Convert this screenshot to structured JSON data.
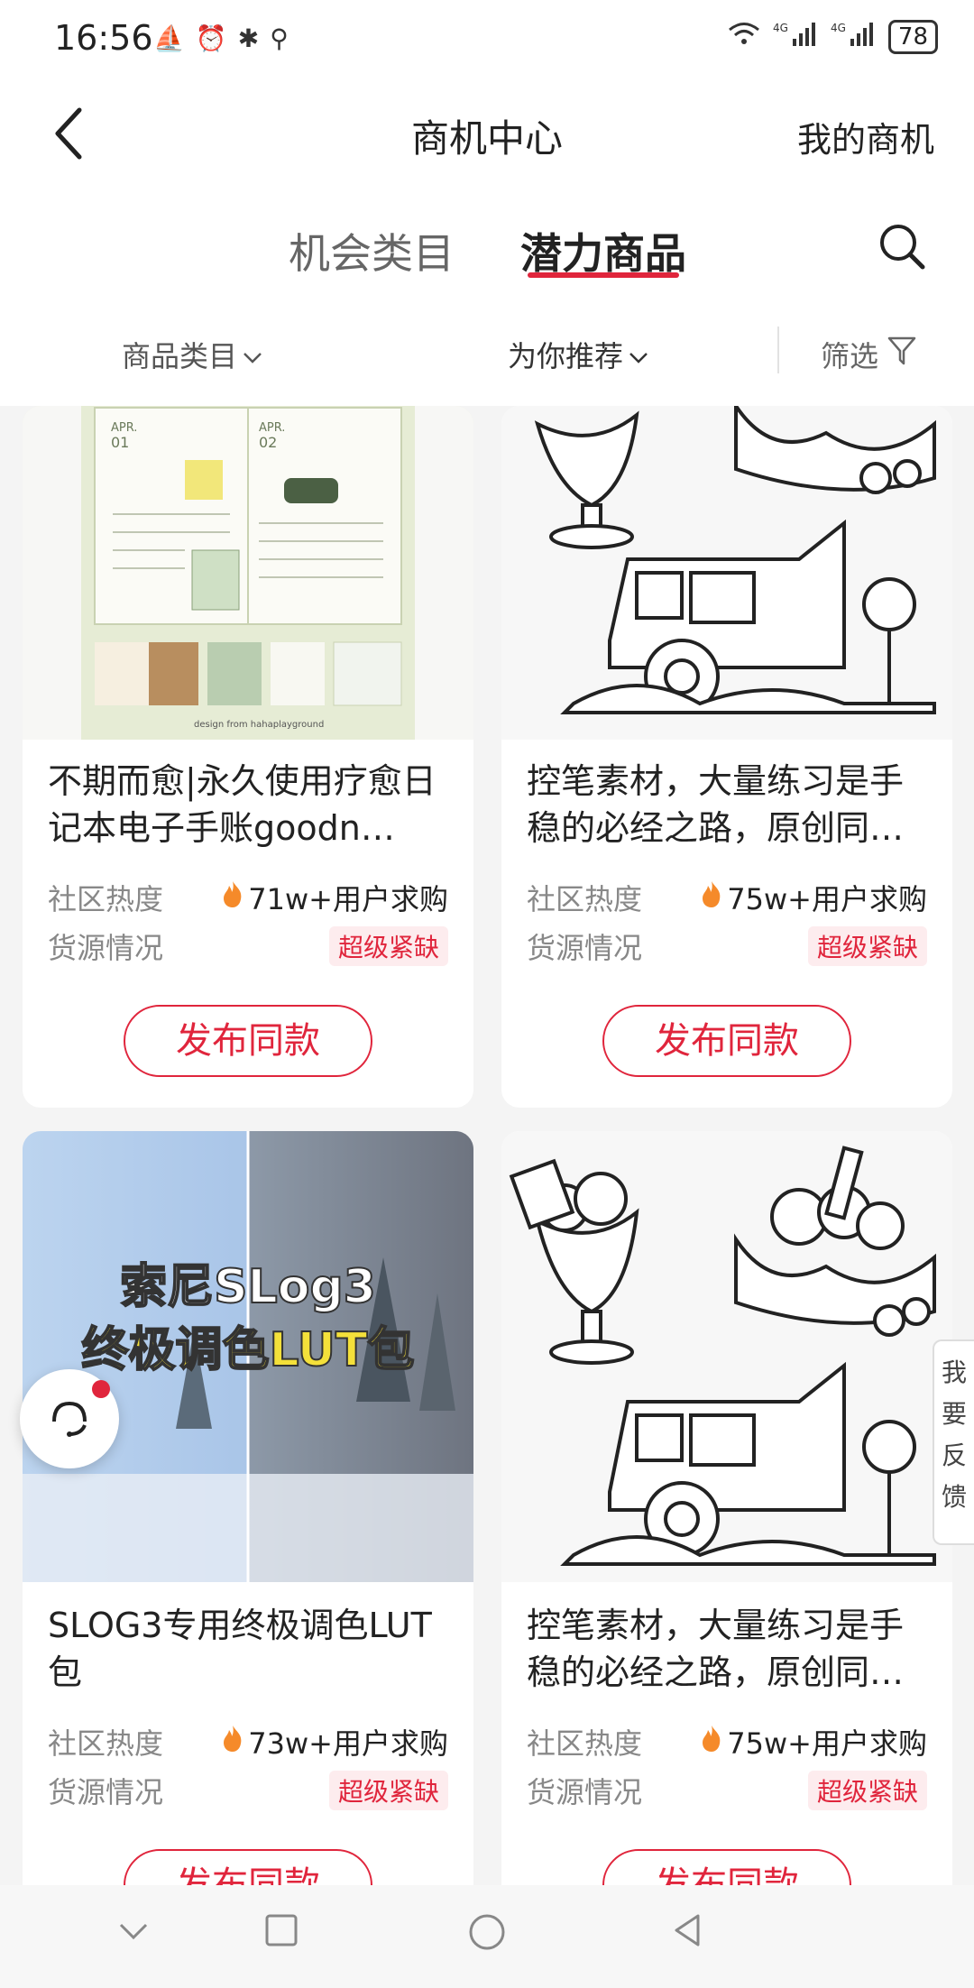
{
  "status_bar": {
    "time": "16:56",
    "battery": "78"
  },
  "header": {
    "title": "商机中心",
    "my_opportunities": "我的商机"
  },
  "tabs": {
    "inactive": "机会类目",
    "active": "潜力商品"
  },
  "filters": {
    "category": "商品类目",
    "recommend": "为你推荐",
    "filter": "筛选"
  },
  "labels": {
    "heat": "社区热度",
    "supply": "货源情况",
    "publish": "发布同款",
    "scarce": "超级紧缺"
  },
  "cards": [
    {
      "title": "不期而愈|永久使用疗愈日记本电子手账goodn…",
      "heat": "71w+用户求购",
      "image_text": "design from hahaplayground",
      "tabs": [
        "APR.",
        "01",
        "APR.",
        "02"
      ]
    },
    {
      "title": "控笔素材，大量练习是手稳的必经之路，原创同…",
      "heat": "75w+用户求购"
    },
    {
      "title": "SLOG3专用终极调色LUT包",
      "heat": "73w+用户求购",
      "overlay_line1": "索尼SLog3",
      "overlay_line2": "终极调色LUT包"
    },
    {
      "title": "控笔素材，大量练习是手稳的必经之路，原创同…",
      "heat": "75w+用户求购"
    }
  ],
  "feedback": {
    "chars": [
      "我",
      "要",
      "反",
      "馈"
    ]
  },
  "colors": {
    "accent": "#e0253c",
    "badge_bg": "#fdecee"
  }
}
